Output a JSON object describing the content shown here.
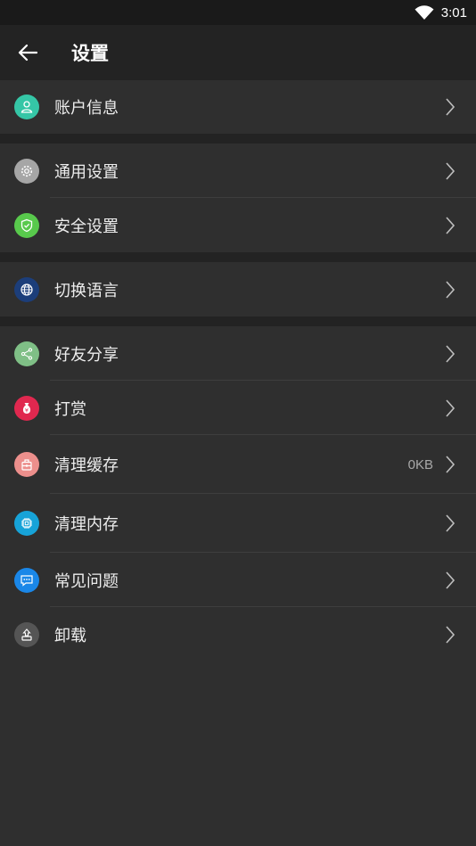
{
  "status_bar": {
    "time": "3:01"
  },
  "header": {
    "title": "设置"
  },
  "groups": [
    {
      "items": [
        {
          "label": "账户信息",
          "icon": "user-icon",
          "color": "#35c6a6"
        }
      ]
    },
    {
      "items": [
        {
          "label": "通用设置",
          "icon": "gear-icon",
          "color": "#a6a6a6"
        },
        {
          "label": "安全设置",
          "icon": "shield-icon",
          "color": "#58c94c"
        }
      ]
    },
    {
      "items": [
        {
          "label": "切换语言",
          "icon": "globe-icon",
          "color": "#1c3e7a"
        }
      ]
    },
    {
      "items": [
        {
          "label": "好友分享",
          "icon": "share-icon",
          "color": "#7fbf86"
        },
        {
          "label": "打赏",
          "icon": "money-bag-icon",
          "color": "#e0284f"
        },
        {
          "label": "清理缓存",
          "icon": "broom-bag-icon",
          "color": "#ec8f8c",
          "value": "0KB"
        },
        {
          "label": "清理内存",
          "icon": "chip-icon",
          "color": "#17a3d8"
        },
        {
          "label": "常见问题",
          "icon": "chat-icon",
          "color": "#1a87e8"
        },
        {
          "label": "卸载",
          "icon": "uninstall-icon",
          "color": "#555555"
        }
      ]
    }
  ]
}
